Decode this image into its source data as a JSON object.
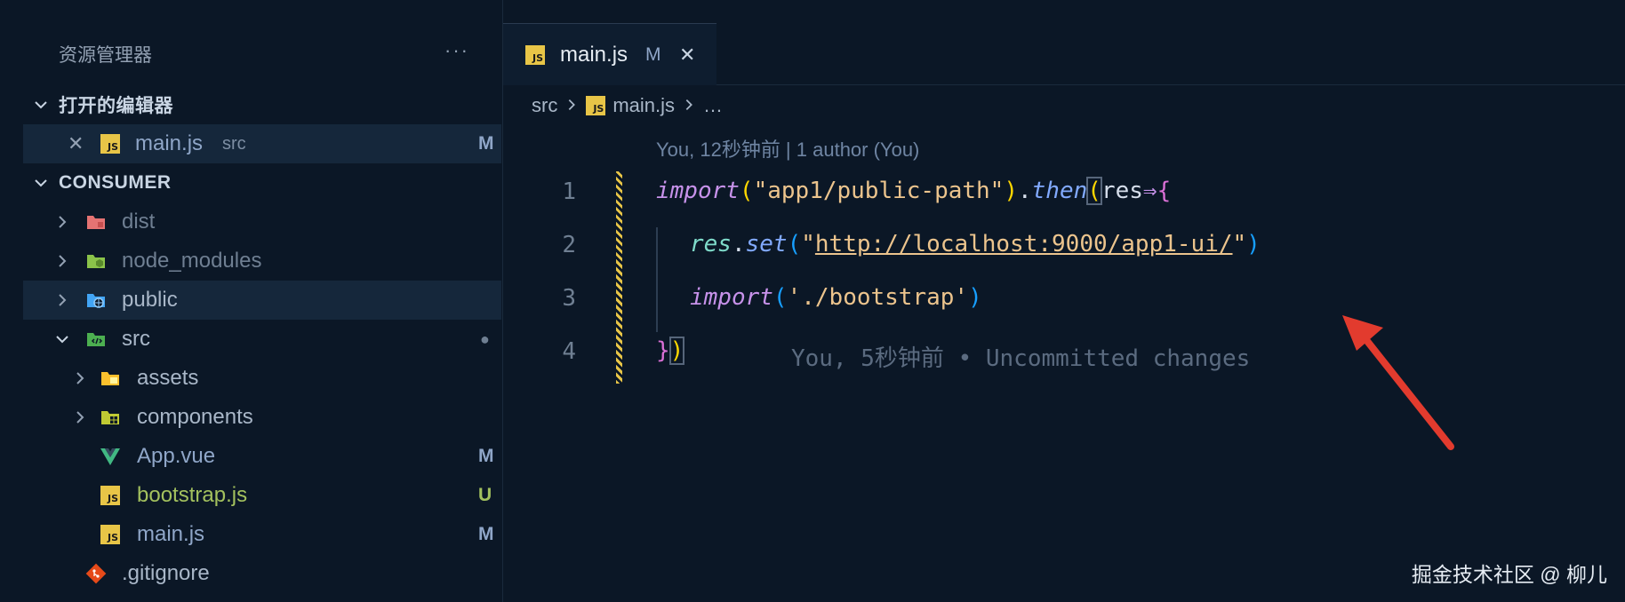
{
  "sidebar": {
    "title": "资源管理器",
    "more": "···",
    "open_editors": {
      "heading": "打开的编辑器",
      "items": [
        {
          "close": "✕",
          "name": "main.js",
          "path": "src",
          "badge": "M"
        }
      ]
    },
    "project": {
      "heading": "CONSUMER",
      "items": [
        {
          "name": "dist"
        },
        {
          "name": "node_modules"
        },
        {
          "name": "public"
        },
        {
          "name": "src",
          "badge": "●"
        },
        {
          "name": "assets"
        },
        {
          "name": "components"
        },
        {
          "name": "App.vue",
          "badge": "M"
        },
        {
          "name": "bootstrap.js",
          "badge": "U"
        },
        {
          "name": "main.js",
          "badge": "M"
        },
        {
          "name": ".gitignore"
        }
      ]
    }
  },
  "editor": {
    "tab": {
      "name": "main.js",
      "badge": "M",
      "close": "✕"
    },
    "breadcrumb": {
      "folder": "src",
      "file": "main.js",
      "more": "…"
    },
    "codelens": "You, 12秒钟前 | 1 author (You)",
    "lines": [
      "1",
      "2",
      "3",
      "4"
    ],
    "code": {
      "l1": {
        "a": "import",
        "b": "(",
        "c": "\"app1/public-path\"",
        "d": ")",
        "e": ".",
        "f": "then",
        "g": "(",
        "h": "res",
        "i": "⇒",
        "j": "{"
      },
      "l2": {
        "a": "res",
        "b": ".",
        "c": "set",
        "d": "(",
        "e": "\"",
        "f": "http://localhost:9000/app1-ui/",
        "g": "\"",
        "h": ")"
      },
      "l3": {
        "a": "import",
        "b": "(",
        "c": "'./bootstrap'",
        "d": ")"
      },
      "l4": {
        "a": "}",
        "b": ")"
      }
    },
    "blame": "You, 5秒钟前 • Uncommitted changes"
  },
  "watermark": "掘金技术社区 @ 柳儿",
  "colors": {
    "background": "#0b1726",
    "modified": "#8fa6c8",
    "untracked": "#a3c15e",
    "annotation_arrow": "#e23b2e"
  }
}
